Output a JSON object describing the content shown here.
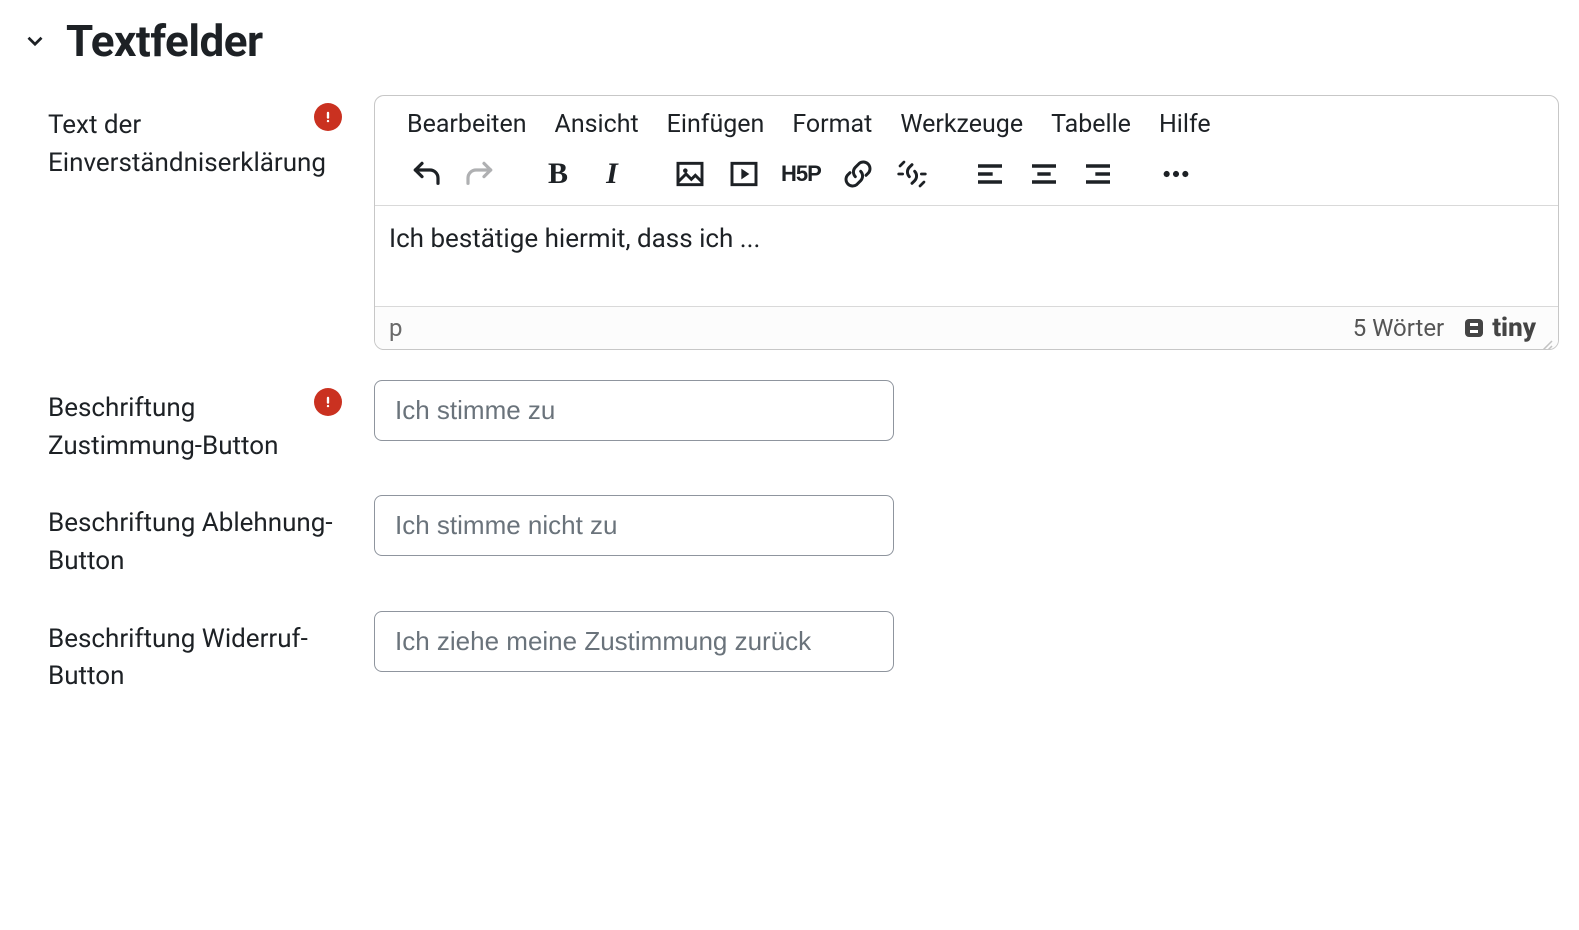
{
  "section": {
    "title": "Textfelder"
  },
  "consentText": {
    "label": "Text der Einverständniserklärung",
    "required": true,
    "body": "Ich bestätige hiermit, dass ich ..."
  },
  "editor": {
    "menubar": {
      "edit": "Bearbeiten",
      "view": "Ansicht",
      "insert": "Einfügen",
      "format": "Format",
      "tools": "Werkzeuge",
      "table": "Tabelle",
      "help": "Hilfe"
    },
    "status": {
      "path": "p",
      "wordCount": "5 Wörter",
      "brand": "tiny"
    }
  },
  "agreeButton": {
    "label": "Beschriftung Zustimmung-Button",
    "required": true,
    "placeholder": "Ich stimme zu",
    "value": ""
  },
  "disagreeButton": {
    "label": "Beschriftung Ablehnung-Button",
    "required": false,
    "placeholder": "Ich stimme nicht zu",
    "value": ""
  },
  "revokeButton": {
    "label": "Beschriftung Widerruf-Button",
    "required": false,
    "placeholder": "Ich ziehe meine Zustimmung zurück",
    "value": ""
  }
}
